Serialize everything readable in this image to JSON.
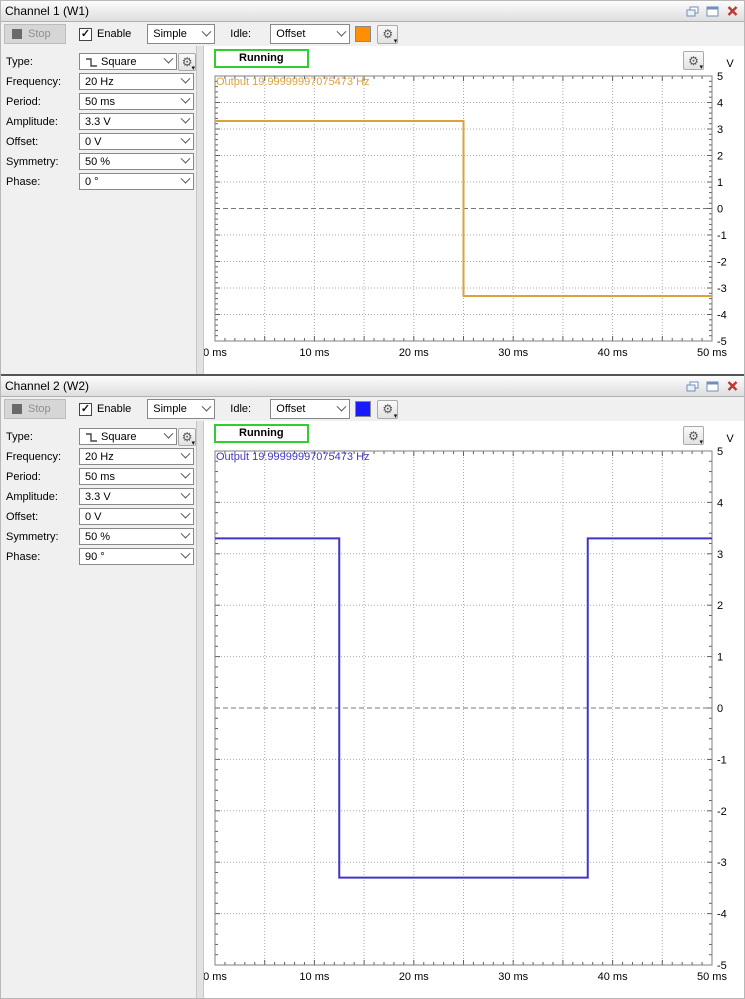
{
  "colors": {
    "ch1_line": "#dca23c",
    "ch2_line": "#4035c8",
    "running_green": "#33cc33",
    "close_red": "#c23535"
  },
  "channels": [
    {
      "title": "Channel 1 (W1)",
      "toolbar": {
        "stop_label": "Stop",
        "enable_label": "Enable",
        "check_glyph": "✓",
        "mode_value": "Simple",
        "idle_label": "Idle:",
        "idle_value": "Offset",
        "swatch_color": "#ff8e00"
      },
      "controls": [
        {
          "label": "Type:",
          "value": "Square"
        },
        {
          "label": "Frequency:",
          "value": "20 Hz"
        },
        {
          "label": "Period:",
          "value": "50 ms"
        },
        {
          "label": "Amplitude:",
          "value": "3.3 V"
        },
        {
          "label": "Offset:",
          "value": "0 V"
        },
        {
          "label": "Symmetry:",
          "value": "50 %"
        },
        {
          "label": "Phase:",
          "value": "0 °"
        }
      ],
      "status": "Running",
      "output_text": "Output 19.99999997075473 Hz",
      "output_color": "#dca23c"
    },
    {
      "title": "Channel 2 (W2)",
      "toolbar": {
        "stop_label": "Stop",
        "enable_label": "Enable",
        "check_glyph": "✓",
        "mode_value": "Simple",
        "idle_label": "Idle:",
        "idle_value": "Offset",
        "swatch_color": "#1a1aff"
      },
      "controls": [
        {
          "label": "Type:",
          "value": "Square"
        },
        {
          "label": "Frequency:",
          "value": "20 Hz"
        },
        {
          "label": "Period:",
          "value": "50 ms"
        },
        {
          "label": "Amplitude:",
          "value": "3.3 V"
        },
        {
          "label": "Offset:",
          "value": "0 V"
        },
        {
          "label": "Symmetry:",
          "value": "50 %"
        },
        {
          "label": "Phase:",
          "value": "90 °"
        }
      ],
      "status": "Running",
      "output_text": "Output 19.99999997075473 Hz",
      "output_color": "#4035c8"
    }
  ],
  "chart_data": [
    {
      "type": "line",
      "title": "Channel 1 (W1) square wave output, 20 Hz, 3.3 V amplitude, 0° phase",
      "xlim": [
        0,
        50
      ],
      "ylim": [
        -5,
        5
      ],
      "x_unit": "ms",
      "y_unit": "V",
      "x_ticks": [
        0,
        10,
        20,
        30,
        40,
        50
      ],
      "x_tick_labels": [
        "0 ms",
        "10 ms",
        "20 ms",
        "30 ms",
        "40 ms",
        "50 ms"
      ],
      "y_ticks": [
        5,
        4,
        3,
        2,
        1,
        0,
        -1,
        -2,
        -3,
        -4,
        -5
      ],
      "x_grid_step": 5,
      "y_grid_step": 1,
      "grid": true,
      "legend": false,
      "series": [
        {
          "name": "W1",
          "color": "#dca23c",
          "points": [
            [
              0,
              3.3
            ],
            [
              25,
              3.3
            ],
            [
              25,
              -3.3
            ],
            [
              50,
              -3.3
            ]
          ]
        }
      ]
    },
    {
      "type": "line",
      "title": "Channel 2 (W2) square wave output, 20 Hz, 3.3 V amplitude, 90° phase",
      "xlim": [
        0,
        50
      ],
      "ylim": [
        -5,
        5
      ],
      "x_unit": "ms",
      "y_unit": "V",
      "x_ticks": [
        0,
        10,
        20,
        30,
        40,
        50
      ],
      "x_tick_labels": [
        "0 ms",
        "10 ms",
        "20 ms",
        "30 ms",
        "40 ms",
        "50 ms"
      ],
      "y_ticks": [
        5,
        4,
        3,
        2,
        1,
        0,
        -1,
        -2,
        -3,
        -4,
        -5
      ],
      "x_grid_step": 5,
      "y_grid_step": 1,
      "grid": true,
      "legend": false,
      "series": [
        {
          "name": "W2",
          "color": "#4035c8",
          "points": [
            [
              0,
              3.3
            ],
            [
              12.5,
              3.3
            ],
            [
              12.5,
              -3.3
            ],
            [
              37.5,
              -3.3
            ],
            [
              37.5,
              3.3
            ],
            [
              50,
              3.3
            ]
          ]
        }
      ]
    }
  ]
}
